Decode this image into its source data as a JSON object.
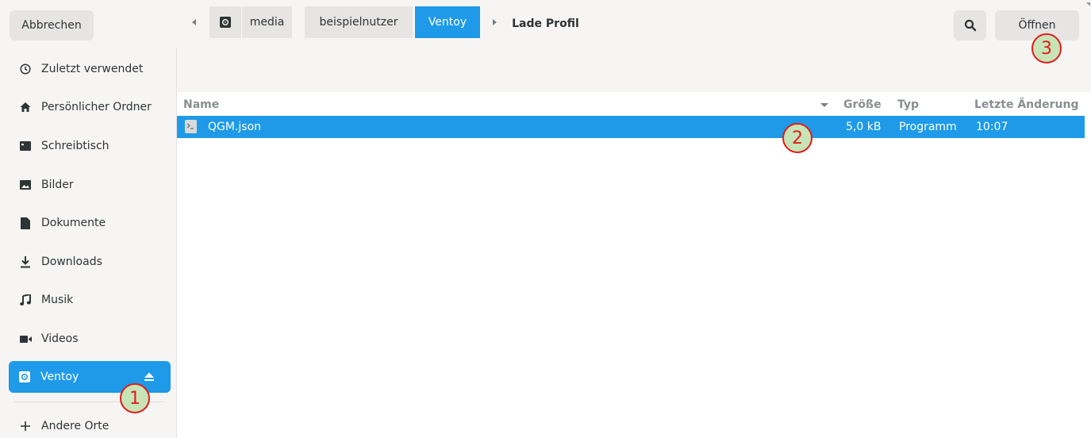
{
  "header": {
    "cancel_label": "Abbrechen",
    "title": "Lade Profil",
    "open_label": "Öffnen"
  },
  "sidebar": {
    "items": [
      {
        "label": "Zuletzt verwendet",
        "icon": "clock-icon"
      },
      {
        "label": "Persönlicher Ordner",
        "icon": "home-icon"
      },
      {
        "label": "Schreibtisch",
        "icon": "desktop-icon"
      },
      {
        "label": "Bilder",
        "icon": "image-icon"
      },
      {
        "label": "Dokumente",
        "icon": "document-icon"
      },
      {
        "label": "Downloads",
        "icon": "download-icon"
      },
      {
        "label": "Musik",
        "icon": "music-icon"
      },
      {
        "label": "Videos",
        "icon": "video-icon"
      },
      {
        "label": "Ventoy",
        "icon": "drive-icon",
        "active": true
      }
    ],
    "other_places_label": "Andere Orte"
  },
  "pathbar": {
    "crumbs": [
      "media",
      "beispielnutzer",
      "Ventoy"
    ],
    "active": "Ventoy"
  },
  "filelist": {
    "columns": {
      "name": "Name",
      "size": "Größe",
      "type": "Typ",
      "modified": "Letzte Änderung"
    },
    "rows": [
      {
        "name": "QGM.json",
        "size": "5,0 kB",
        "type": "Programm",
        "modified": "10:07",
        "selected": true
      }
    ]
  },
  "annotations": [
    "1",
    "2",
    "3"
  ],
  "colors": {
    "accent": "#1e9ae8",
    "marker_border": "#e21b1b",
    "marker_fill": "#c7e4b6"
  }
}
